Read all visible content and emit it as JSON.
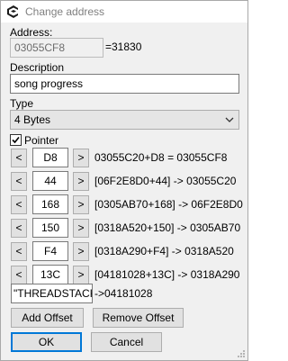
{
  "window": {
    "title": "Change address"
  },
  "address": {
    "label": "Address:",
    "value": "03055CF8",
    "suffix": "=31830"
  },
  "description": {
    "label": "Description",
    "value": "song progress"
  },
  "type": {
    "label": "Type",
    "selected": "4 Bytes"
  },
  "pointer": {
    "label": "Pointer",
    "checked": true
  },
  "offsets": [
    {
      "value": "D8",
      "dec": "<",
      "inc": ">",
      "expr": "03055C20+D8 = 03055CF8"
    },
    {
      "value": "44",
      "dec": "<",
      "inc": ">",
      "expr": "[06F2E8D0+44] -> 03055C20"
    },
    {
      "value": "168",
      "dec": "<",
      "inc": ">",
      "expr": "[0305AB70+168] -> 06F2E8D0"
    },
    {
      "value": "150",
      "dec": "<",
      "inc": ">",
      "expr": "[0318A520+150] -> 0305AB70"
    },
    {
      "value": "F4",
      "dec": "<",
      "inc": ">",
      "expr": "[0318A290+F4] -> 0318A520"
    },
    {
      "value": "13C",
      "dec": "<",
      "inc": ">",
      "expr": "[04181028+13C] -> 0318A290"
    }
  ],
  "base": {
    "value": "\"THREADSTACK",
    "expr": "->04181028"
  },
  "buttons": {
    "add_offset": "Add Offset",
    "remove_offset": "Remove Offset",
    "ok": "OK",
    "cancel": "Cancel"
  },
  "colors": {
    "focus_blue": "#0078d7",
    "title_gray": "#808080"
  }
}
